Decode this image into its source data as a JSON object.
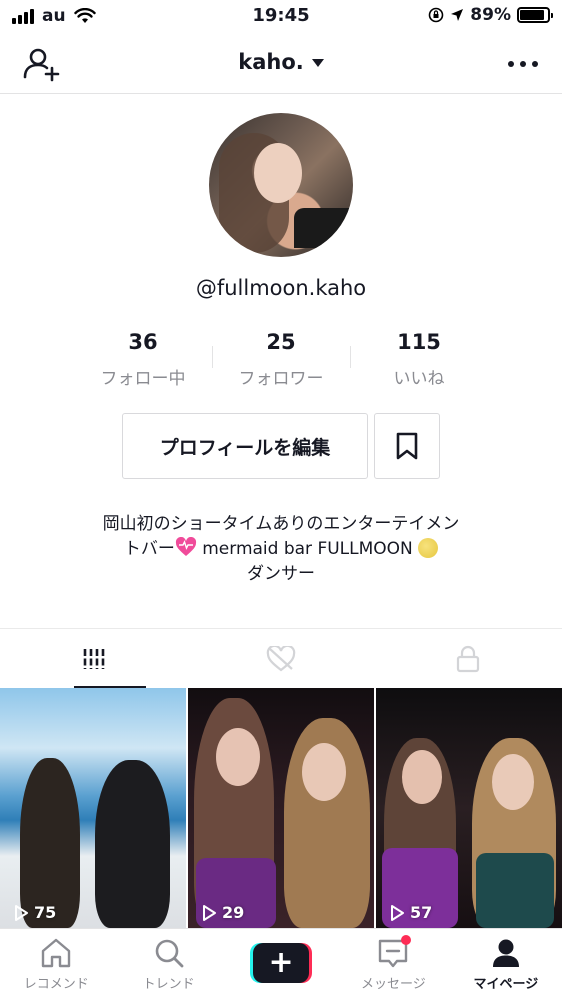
{
  "status_bar": {
    "carrier": "au",
    "time": "19:45",
    "battery_percent": "89%",
    "battery_level": 0.89
  },
  "header": {
    "title": "kaho.",
    "icons": {
      "left": "add-user-icon",
      "right": "more-icon"
    }
  },
  "profile": {
    "username": "@fullmoon.kaho",
    "stats": [
      {
        "num": "36",
        "label": "フォロー中"
      },
      {
        "num": "25",
        "label": "フォロワー"
      },
      {
        "num": "115",
        "label": "いいね"
      }
    ],
    "edit_button": "プロフィールを編集",
    "bio": {
      "line1": "岡山初のショータイムありのエンターテイメン",
      "line2_a": "トバー",
      "line2_b": " mermaid bar FULLMOON ",
      "line3": "ダンサー"
    }
  },
  "tabs": [
    "videos-grid-icon",
    "liked-icon",
    "private-lock-icon"
  ],
  "videos": [
    {
      "views": "75"
    },
    {
      "views": "29"
    },
    {
      "views": "57"
    }
  ],
  "bottom_nav": [
    {
      "label": "レコメンド",
      "icon": "home-icon"
    },
    {
      "label": "トレンド",
      "icon": "search-icon"
    },
    {
      "label": "",
      "icon": "create-plus-icon"
    },
    {
      "label": "メッセージ",
      "icon": "inbox-icon"
    },
    {
      "label": "マイページ",
      "icon": "profile-icon"
    }
  ],
  "colors": {
    "accent_red": "#fe2c55",
    "accent_cyan": "#25f4ee",
    "text_primary": "#161823",
    "text_secondary": "#8a8b91"
  }
}
